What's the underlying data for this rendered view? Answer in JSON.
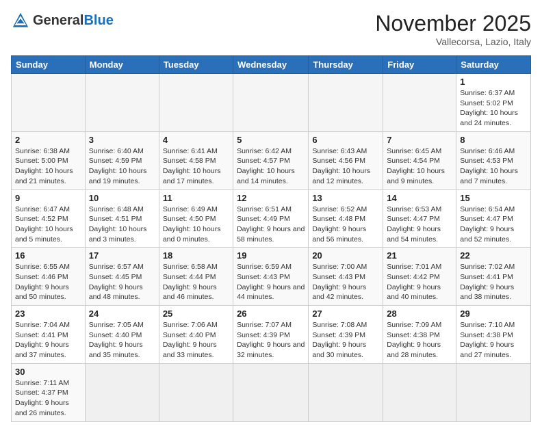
{
  "logo": {
    "text_general": "General",
    "text_blue": "Blue"
  },
  "title": "November 2025",
  "subtitle": "Vallecorsa, Lazio, Italy",
  "days_of_week": [
    "Sunday",
    "Monday",
    "Tuesday",
    "Wednesday",
    "Thursday",
    "Friday",
    "Saturday"
  ],
  "weeks": [
    {
      "days": [
        {
          "number": "",
          "info": ""
        },
        {
          "number": "",
          "info": ""
        },
        {
          "number": "",
          "info": ""
        },
        {
          "number": "",
          "info": ""
        },
        {
          "number": "",
          "info": ""
        },
        {
          "number": "",
          "info": ""
        },
        {
          "number": "1",
          "info": "Sunrise: 6:37 AM\nSunset: 5:02 PM\nDaylight: 10 hours\nand 24 minutes."
        }
      ]
    },
    {
      "days": [
        {
          "number": "2",
          "info": "Sunrise: 6:38 AM\nSunset: 5:00 PM\nDaylight: 10 hours\nand 21 minutes."
        },
        {
          "number": "3",
          "info": "Sunrise: 6:40 AM\nSunset: 4:59 PM\nDaylight: 10 hours\nand 19 minutes."
        },
        {
          "number": "4",
          "info": "Sunrise: 6:41 AM\nSunset: 4:58 PM\nDaylight: 10 hours\nand 17 minutes."
        },
        {
          "number": "5",
          "info": "Sunrise: 6:42 AM\nSunset: 4:57 PM\nDaylight: 10 hours\nand 14 minutes."
        },
        {
          "number": "6",
          "info": "Sunrise: 6:43 AM\nSunset: 4:56 PM\nDaylight: 10 hours\nand 12 minutes."
        },
        {
          "number": "7",
          "info": "Sunrise: 6:45 AM\nSunset: 4:54 PM\nDaylight: 10 hours\nand 9 minutes."
        },
        {
          "number": "8",
          "info": "Sunrise: 6:46 AM\nSunset: 4:53 PM\nDaylight: 10 hours\nand 7 minutes."
        }
      ]
    },
    {
      "days": [
        {
          "number": "9",
          "info": "Sunrise: 6:47 AM\nSunset: 4:52 PM\nDaylight: 10 hours\nand 5 minutes."
        },
        {
          "number": "10",
          "info": "Sunrise: 6:48 AM\nSunset: 4:51 PM\nDaylight: 10 hours\nand 3 minutes."
        },
        {
          "number": "11",
          "info": "Sunrise: 6:49 AM\nSunset: 4:50 PM\nDaylight: 10 hours\nand 0 minutes."
        },
        {
          "number": "12",
          "info": "Sunrise: 6:51 AM\nSunset: 4:49 PM\nDaylight: 9 hours\nand 58 minutes."
        },
        {
          "number": "13",
          "info": "Sunrise: 6:52 AM\nSunset: 4:48 PM\nDaylight: 9 hours\nand 56 minutes."
        },
        {
          "number": "14",
          "info": "Sunrise: 6:53 AM\nSunset: 4:47 PM\nDaylight: 9 hours\nand 54 minutes."
        },
        {
          "number": "15",
          "info": "Sunrise: 6:54 AM\nSunset: 4:47 PM\nDaylight: 9 hours\nand 52 minutes."
        }
      ]
    },
    {
      "days": [
        {
          "number": "16",
          "info": "Sunrise: 6:55 AM\nSunset: 4:46 PM\nDaylight: 9 hours\nand 50 minutes."
        },
        {
          "number": "17",
          "info": "Sunrise: 6:57 AM\nSunset: 4:45 PM\nDaylight: 9 hours\nand 48 minutes."
        },
        {
          "number": "18",
          "info": "Sunrise: 6:58 AM\nSunset: 4:44 PM\nDaylight: 9 hours\nand 46 minutes."
        },
        {
          "number": "19",
          "info": "Sunrise: 6:59 AM\nSunset: 4:43 PM\nDaylight: 9 hours\nand 44 minutes."
        },
        {
          "number": "20",
          "info": "Sunrise: 7:00 AM\nSunset: 4:43 PM\nDaylight: 9 hours\nand 42 minutes."
        },
        {
          "number": "21",
          "info": "Sunrise: 7:01 AM\nSunset: 4:42 PM\nDaylight: 9 hours\nand 40 minutes."
        },
        {
          "number": "22",
          "info": "Sunrise: 7:02 AM\nSunset: 4:41 PM\nDaylight: 9 hours\nand 38 minutes."
        }
      ]
    },
    {
      "days": [
        {
          "number": "23",
          "info": "Sunrise: 7:04 AM\nSunset: 4:41 PM\nDaylight: 9 hours\nand 37 minutes."
        },
        {
          "number": "24",
          "info": "Sunrise: 7:05 AM\nSunset: 4:40 PM\nDaylight: 9 hours\nand 35 minutes."
        },
        {
          "number": "25",
          "info": "Sunrise: 7:06 AM\nSunset: 4:40 PM\nDaylight: 9 hours\nand 33 minutes."
        },
        {
          "number": "26",
          "info": "Sunrise: 7:07 AM\nSunset: 4:39 PM\nDaylight: 9 hours\nand 32 minutes."
        },
        {
          "number": "27",
          "info": "Sunrise: 7:08 AM\nSunset: 4:39 PM\nDaylight: 9 hours\nand 30 minutes."
        },
        {
          "number": "28",
          "info": "Sunrise: 7:09 AM\nSunset: 4:38 PM\nDaylight: 9 hours\nand 28 minutes."
        },
        {
          "number": "29",
          "info": "Sunrise: 7:10 AM\nSunset: 4:38 PM\nDaylight: 9 hours\nand 27 minutes."
        }
      ]
    },
    {
      "days": [
        {
          "number": "30",
          "info": "Sunrise: 7:11 AM\nSunset: 4:37 PM\nDaylight: 9 hours\nand 26 minutes."
        },
        {
          "number": "",
          "info": ""
        },
        {
          "number": "",
          "info": ""
        },
        {
          "number": "",
          "info": ""
        },
        {
          "number": "",
          "info": ""
        },
        {
          "number": "",
          "info": ""
        },
        {
          "number": "",
          "info": ""
        }
      ]
    }
  ]
}
